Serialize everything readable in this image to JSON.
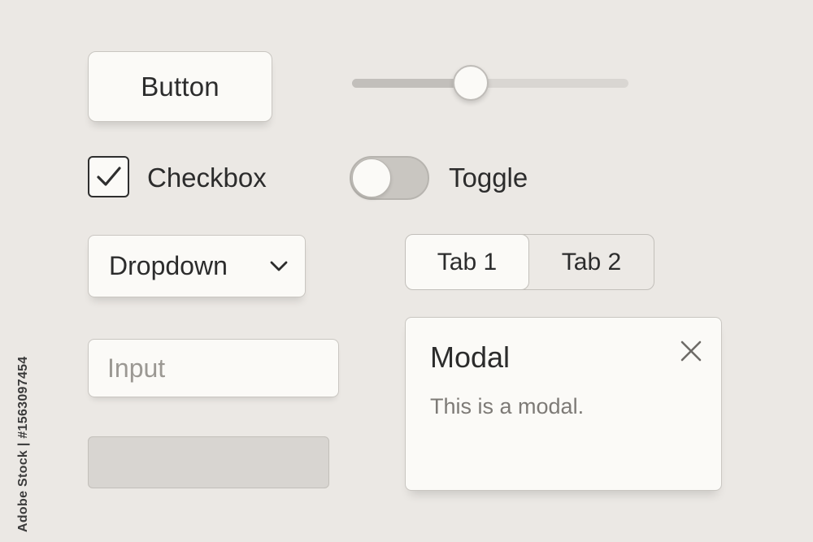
{
  "button": {
    "label": "Button"
  },
  "slider": {
    "value": 0.43
  },
  "checkbox": {
    "label": "Checkbox",
    "checked": true
  },
  "toggle": {
    "label": "Toggle",
    "on": false
  },
  "dropdown": {
    "label": "Dropdown",
    "icon": "chevron-down-icon"
  },
  "tabs": [
    {
      "label": "Tab 1",
      "active": true
    },
    {
      "label": "Tab 2",
      "active": false
    }
  ],
  "input": {
    "placeholder": "Input",
    "value": ""
  },
  "modal": {
    "title": "Modal",
    "body": "This is a modal.",
    "close_icon": "close-icon"
  },
  "watermark": {
    "side_text": "Adobe Stock | #1563097454"
  },
  "colors": {
    "background": "#ebe8e4",
    "surface": "#fbfaf7",
    "border": "#c9c6c1",
    "text": "#2c2c2c",
    "muted_text": "#7d7a76"
  }
}
